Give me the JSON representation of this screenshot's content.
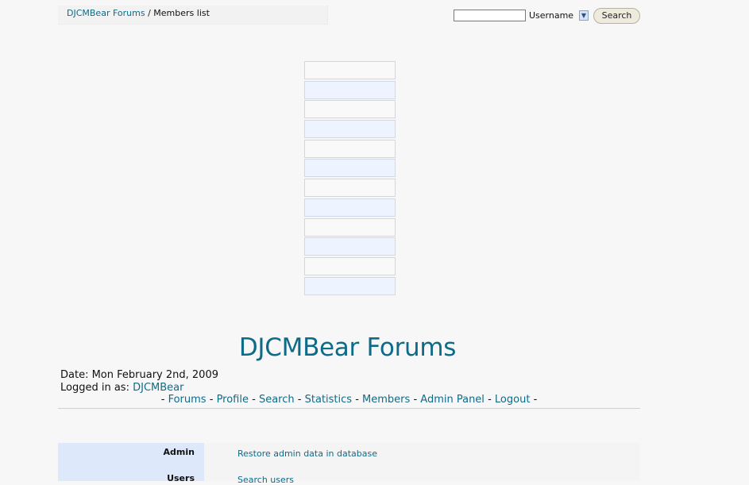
{
  "breadcrumb": {
    "home": "DJCMBear Forums",
    "separator": "/",
    "current": "Members list"
  },
  "search": {
    "select_value": "Username",
    "button_label": "Search",
    "dropdown_icon": "chevron-down-icon"
  },
  "forum": {
    "title": "DJCMBear Forums"
  },
  "meta": {
    "date_prefix": "Date:",
    "date": "Mon February 2nd, 2009",
    "logged_in_prefix": "Logged in as:",
    "username": "DJCMBear"
  },
  "nav": {
    "links": [
      "Forums",
      "Profile",
      "Search",
      "Statistics",
      "Members",
      "Admin Panel",
      "Logout"
    ],
    "separator": "-"
  },
  "admin": {
    "sections": [
      {
        "label": "Admin",
        "link": "Restore admin data in database"
      },
      {
        "label": "Users",
        "link": "Search users"
      }
    ]
  },
  "colors": {
    "link": "#0e6b88",
    "row_alt": "#eef4ff",
    "label_col": "#dde9fb"
  }
}
